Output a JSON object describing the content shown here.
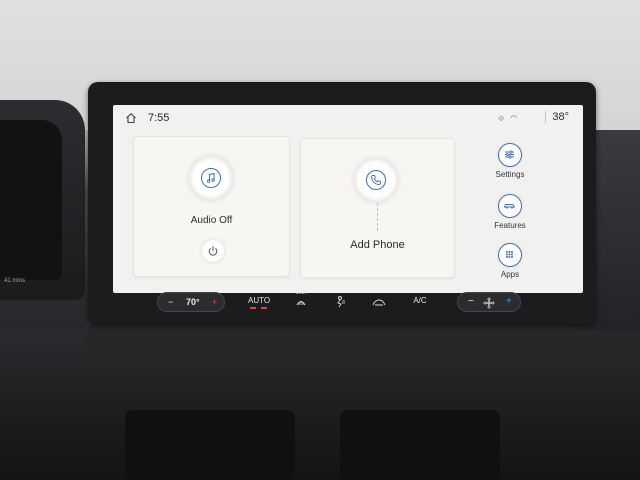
{
  "status_bar": {
    "time": "7:55",
    "outside_temp": "38°",
    "icons": [
      "home-icon",
      "connectivity-icon",
      "wifi-icon"
    ]
  },
  "cards": {
    "audio": {
      "label": "Audio Off",
      "icon": "music-note-icon",
      "power_icon": "power-icon"
    },
    "phone": {
      "label": "Add Phone",
      "icon": "phone-icon"
    }
  },
  "side_buttons": [
    {
      "label": "Settings",
      "icon": "sliders-icon"
    },
    {
      "label": "Features",
      "icon": "vehicle-icon"
    },
    {
      "label": "Apps",
      "icon": "grid-icon"
    }
  ],
  "climate": {
    "temp_minus": "−",
    "temp_value": "70°",
    "temp_plus": "+",
    "auto_label": "AUTO",
    "max_label": "MAX",
    "ac_label": "A/C",
    "fan_minus": "−",
    "fan_plus": "+"
  },
  "cluster": {
    "text": "41 mins"
  },
  "colors": {
    "accent": "#3e6fb6",
    "status_red": "#e0453c"
  }
}
